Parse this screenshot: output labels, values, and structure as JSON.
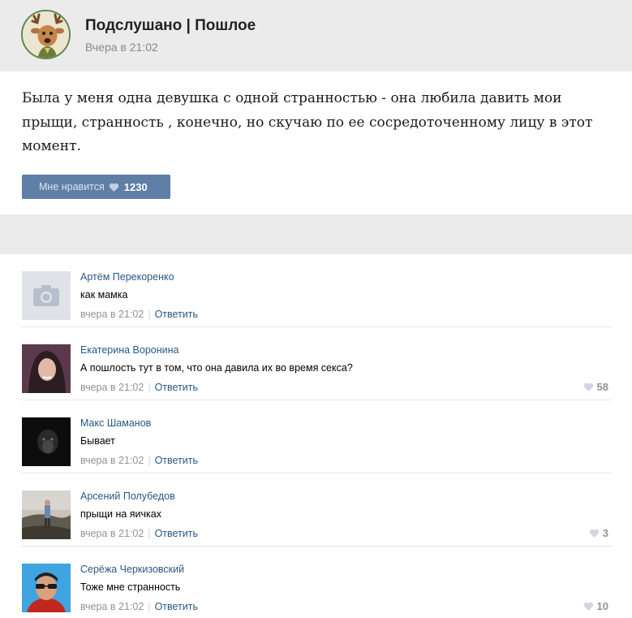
{
  "post": {
    "group_name": "Подслушано | Пошлое",
    "time": "Вчера в 21:02",
    "text": "Была у меня одна девушка с одной странностью - она любила давить мои прыщи, странность , конечно, но скучаю по ее сосредоточенному лицу в этот момент.",
    "like_label": "Мне нравится",
    "like_count": "1230",
    "icon": "deer-avatar-icon"
  },
  "comments": [
    {
      "author": "Артём Перекоренко",
      "text": "как мамка",
      "time": "вчера в 21:02",
      "reply": "Ответить",
      "likes": ""
    },
    {
      "author": "Екатерина Воронина",
      "text": "А пошлость тут в том, что она давила их во время секса?",
      "time": "вчера в 21:02",
      "reply": "Ответить",
      "likes": "58"
    },
    {
      "author": "Макс Шаманов",
      "text": "Бывает",
      "time": "вчера в 21:02",
      "reply": "Ответить",
      "likes": ""
    },
    {
      "author": "Арсений Полубедов",
      "text": "прыщи на яичках",
      "time": "вчера в 21:02",
      "reply": "Ответить",
      "likes": "3"
    },
    {
      "author": "Серёжа Черкизовский",
      "text": "Тоже мне странность",
      "time": "вчера в 21:02",
      "reply": "Ответить",
      "likes": "10"
    }
  ],
  "colors": {
    "header_bg": "#ebebeb",
    "like_button": "#5f7fa6",
    "link": "#2a5885",
    "meta": "#939393"
  }
}
